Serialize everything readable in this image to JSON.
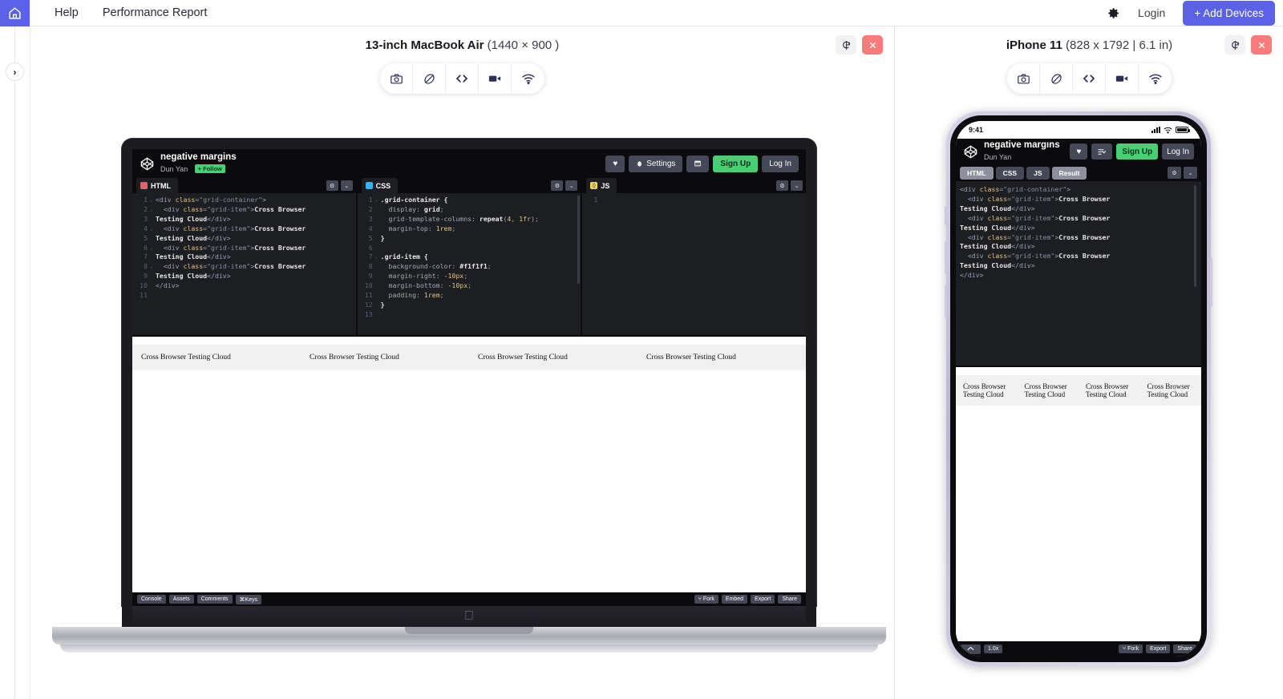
{
  "topnav": {
    "home_icon": "home-icon",
    "links": [
      "Help",
      "Performance Report"
    ],
    "gear_icon": "gear-icon",
    "login": "Login",
    "add_devices": "+ Add Devices",
    "accent": "#5b62e8"
  },
  "rail": {
    "toggle_icon": "chevron-right-icon"
  },
  "toolbar_items": [
    {
      "name": "screenshot-icon",
      "glyph": "camera"
    },
    {
      "name": "rotate-icon",
      "glyph": "rotate"
    },
    {
      "name": "code-inspect-icon",
      "glyph": "code"
    },
    {
      "name": "record-video-icon",
      "glyph": "video"
    },
    {
      "name": "network-throttle-icon",
      "glyph": "wifi"
    }
  ],
  "panes": [
    {
      "device_name": "13-inch MacBook Air",
      "device_spec": "(1440 × 900 )",
      "refresh_icon": "refresh-icon",
      "close_icon": "close-icon"
    },
    {
      "device_name": "iPhone 11",
      "device_spec": "(828 x 1792 | 6.1 in)",
      "refresh_icon": "refresh-icon",
      "close_icon": "close-icon"
    }
  ],
  "codepen": {
    "pen_title": "negative margins",
    "author": "Dun Yan",
    "follow": "+ Follow",
    "buttons": {
      "love": "♥",
      "settings": "Settings",
      "change_view": "⊞",
      "sign_up": "Sign Up",
      "log_in": "Log In"
    },
    "editors": [
      {
        "tab": "HTML",
        "dot": "dot-html",
        "lines": [
          "<div class=\"grid-container\">",
          "  <div class=\"grid-item\">Cross Browser",
          "Testing Cloud</div>",
          "  <div class=\"grid-item\">Cross Browser",
          "Testing Cloud</div>",
          "  <div class=\"grid-item\">Cross Browser",
          "Testing Cloud</div>",
          "  <div class=\"grid-item\">Cross Browser",
          "Testing Cloud</div>",
          "</div>",
          ""
        ]
      },
      {
        "tab": "CSS",
        "dot": "dot-css",
        "lines": [
          ".grid-container {",
          "  display: grid;",
          "  grid-template-columns: repeat(4, 1fr);",
          "  margin-top: 1rem;",
          "}",
          "",
          ".grid-item {",
          "  background-color: #f1f1f1;",
          "  margin-right: -10px;",
          "  margin-bottom: -10px;",
          "  padding: 1rem;",
          "}",
          ""
        ]
      },
      {
        "tab": "JS",
        "dot": "dot-js",
        "lines": [
          ""
        ]
      }
    ],
    "result_items": [
      "Cross Browser Testing Cloud",
      "Cross Browser Testing Cloud",
      "Cross Browser Testing Cloud",
      "Cross Browser Testing Cloud"
    ],
    "footer_left": [
      "Console",
      "Assets",
      "Comments",
      "⌘Keys"
    ],
    "footer_right": [
      "⑂ Fork",
      "Embed",
      "Export",
      "Share"
    ],
    "mobile_tabs": [
      "HTML",
      "CSS",
      "JS",
      "Result"
    ],
    "mobile_active_tab": "Result",
    "mobile_zoom": "1.0x",
    "mobile_footer_right": [
      "⑂ Fork",
      "Export",
      "Share"
    ],
    "mobile_collapse_icon": "chevron-up-icon"
  },
  "ios": {
    "time": "9:41",
    "signal_icon": "cellular-bars-icon",
    "wifi_icon": "wifi-icon",
    "battery_icon": "battery-icon"
  }
}
